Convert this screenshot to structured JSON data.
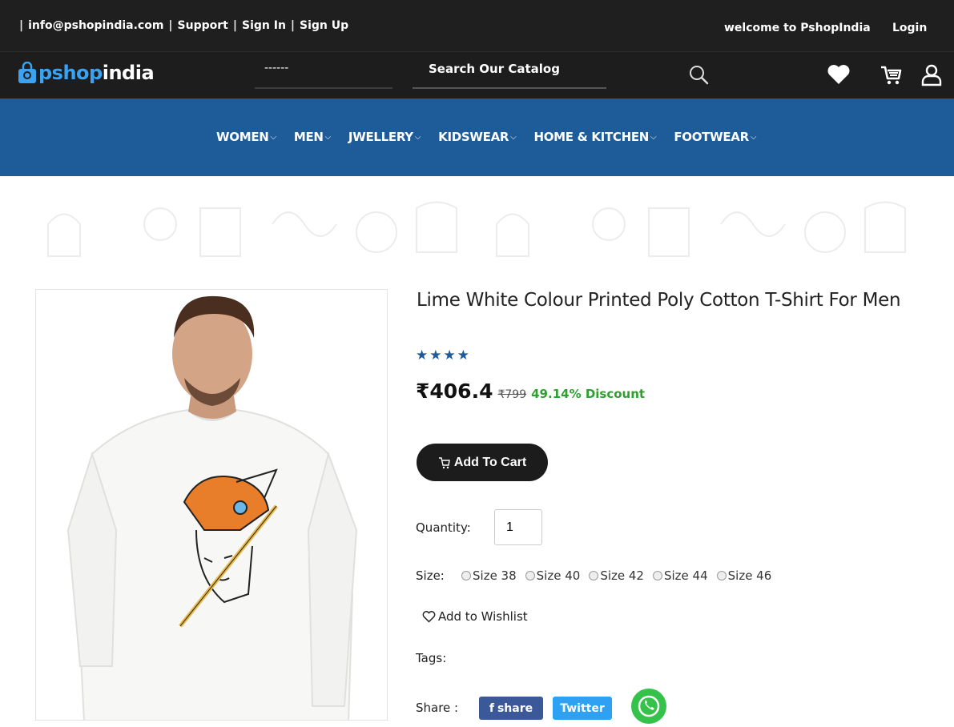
{
  "topbar": {
    "email": "info@pshopindia.com",
    "support": "Support",
    "sign_in": "Sign In",
    "sign_up": "Sign Up",
    "separator": "|",
    "welcome": "welcome to PshopIndia",
    "login": "Login"
  },
  "header": {
    "logo_part1": "pshop",
    "logo_part2": "india",
    "select_value": "------",
    "search_placeholder": "Search Our Catalog"
  },
  "nav": {
    "items": [
      {
        "label": "WOMEN"
      },
      {
        "label": "MEN"
      },
      {
        "label": "JWELLERY"
      },
      {
        "label": "KIDSWEAR"
      },
      {
        "label": "HOME & KITCHEN"
      },
      {
        "label": "FOOTWEAR"
      }
    ]
  },
  "product": {
    "title": "Lime White Colour Printed Poly Cotton T-Shirt For Men",
    "stars": "★★★★",
    "rating": 4,
    "price": "₹406.4",
    "old_price": "₹799",
    "discount": "49.14% Discount",
    "add_to_cart": "Add To Cart",
    "quantity_label": "Quantity:",
    "quantity_value": "1",
    "size_label": "Size:",
    "sizes": [
      "Size 38",
      "Size 40",
      "Size 42",
      "Size 44",
      "Size 46"
    ],
    "wishlist": "Add to Wishlist",
    "tags_label": "Tags:",
    "share_label": "Share :",
    "share_fb": "share",
    "share_twitter": "Twitter"
  },
  "colors": {
    "nav_blue": "#1d5c99",
    "topbar_dark": "#1f1f1f",
    "discount_green": "#2fa02f",
    "logo_blue": "#3aa2f0"
  }
}
